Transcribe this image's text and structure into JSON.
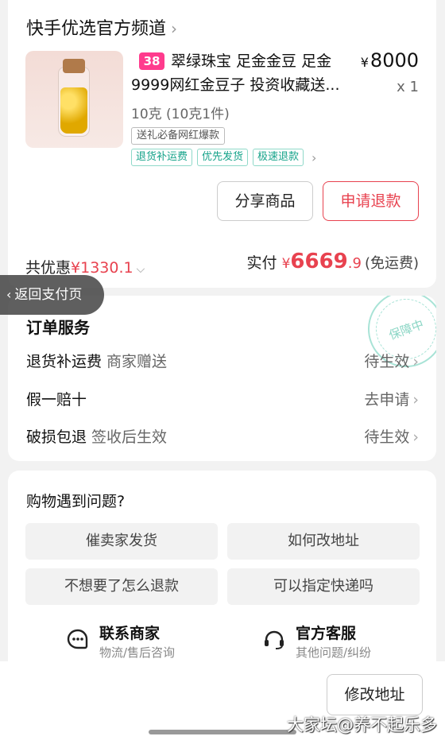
{
  "shop": {
    "title": "快手优选官方频道",
    "chevron": "›"
  },
  "product": {
    "promo_tag": "38",
    "name": "翠绿珠宝 足金金豆 足金9999网红金豆子 投资收藏送...",
    "price_symbol": "¥",
    "price": "8000",
    "quantity": "x 1",
    "spec": "10克 (10克1件)",
    "gift_tag": "送礼必备网红爆款",
    "service_tags": [
      "退货补运费",
      "优先发货",
      "极速退款"
    ]
  },
  "actions": {
    "share_label": "分享商品",
    "refund_label": "申请退款"
  },
  "summary": {
    "discount_label": "共优惠",
    "discount_amount": "¥1330.1",
    "paid_label": "实付",
    "paid_symbol": "¥",
    "paid_int": "6669",
    "paid_dec": ".9",
    "shipping_note": "(免运费)"
  },
  "back_pill": {
    "label": "返回支付页"
  },
  "services": {
    "title": "订单服务",
    "stamp": "保障中",
    "rows": [
      {
        "name": "退货补运费",
        "sub": "商家赠送",
        "status": "待生效"
      },
      {
        "name": "假一赔十",
        "sub": "",
        "status": "去申请"
      },
      {
        "name": "破损包退",
        "sub": "签收后生效",
        "status": "待生效"
      }
    ]
  },
  "help": {
    "title": "购物遇到问题?",
    "questions": [
      "催卖家发货",
      "如何改地址",
      "不想要了怎么退款",
      "可以指定快递吗"
    ],
    "contacts": [
      {
        "title": "联系商家",
        "sub": "物流/售后咨询",
        "icon": "chat-icon"
      },
      {
        "title": "官方客服",
        "sub": "其他问题/纠纷",
        "icon": "headset-icon"
      }
    ]
  },
  "bottom": {
    "modify_address_label": "修改地址",
    "watermark": "大家坛@养不起乐多"
  },
  "colors": {
    "accent_red": "#e8424f",
    "tag_pink": "#ff3b8d",
    "service_green": "#16a38a"
  }
}
